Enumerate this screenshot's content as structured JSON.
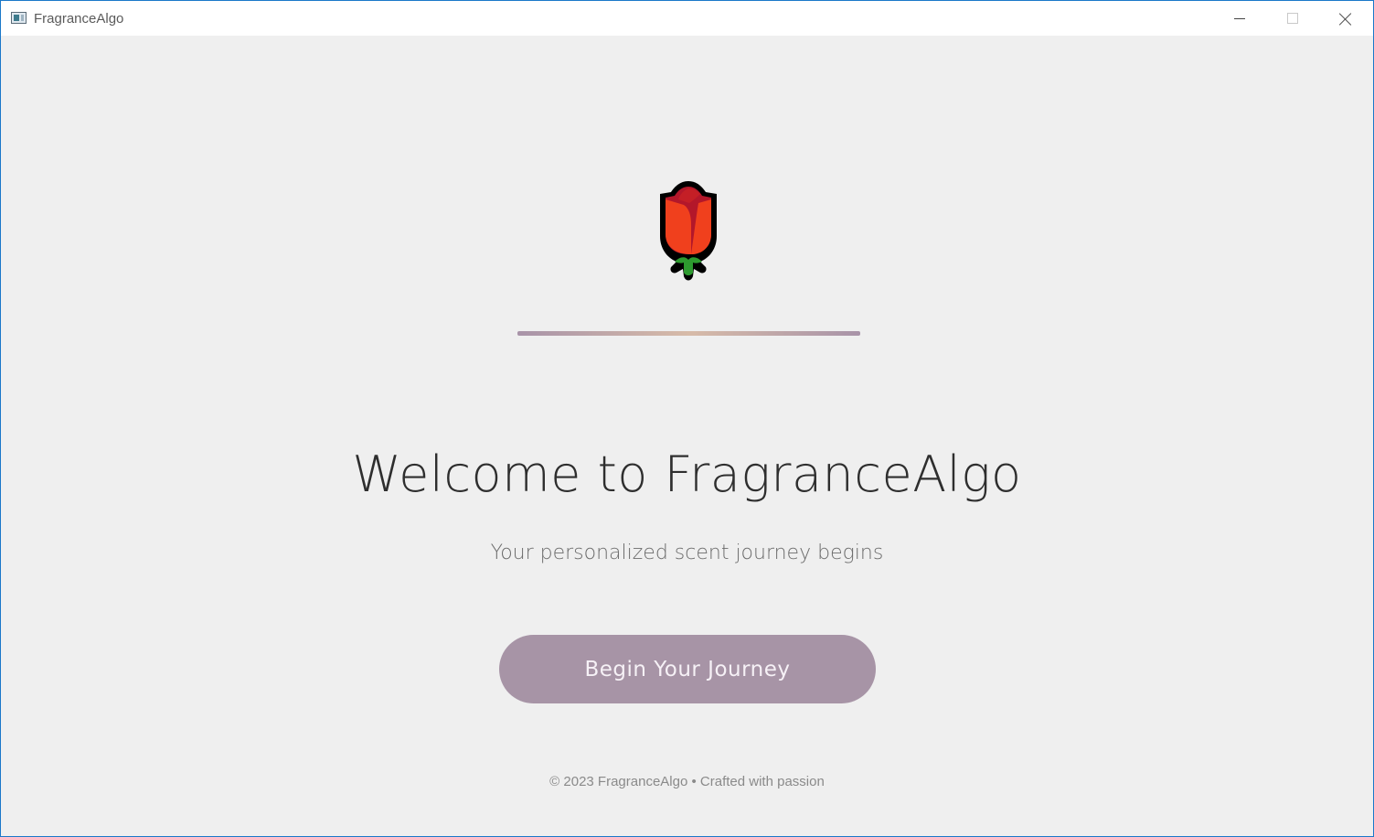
{
  "window": {
    "title": "FragranceAlgo",
    "controls": {
      "minimize_icon": "minimize-icon",
      "maximize_icon": "maximize-icon",
      "close_icon": "close-icon"
    }
  },
  "hero": {
    "logo_icon": "rose-icon",
    "heading": "Welcome to FragranceAlgo",
    "subheading": "Your personalized scent journey begins",
    "cta_label": "Begin Your Journey"
  },
  "footer": {
    "text": "© 2023 FragranceAlgo • Crafted with passion"
  },
  "colors": {
    "background": "#efefef",
    "button": "#a794a6",
    "button_text": "#f6f1f6",
    "divider_start": "#a893a8",
    "divider_mid": "#d7bba8",
    "heading": "#2e2e2e",
    "subheading": "#6c6c6c",
    "footer": "#8a8a8a",
    "window_border": "#1b78c9"
  }
}
